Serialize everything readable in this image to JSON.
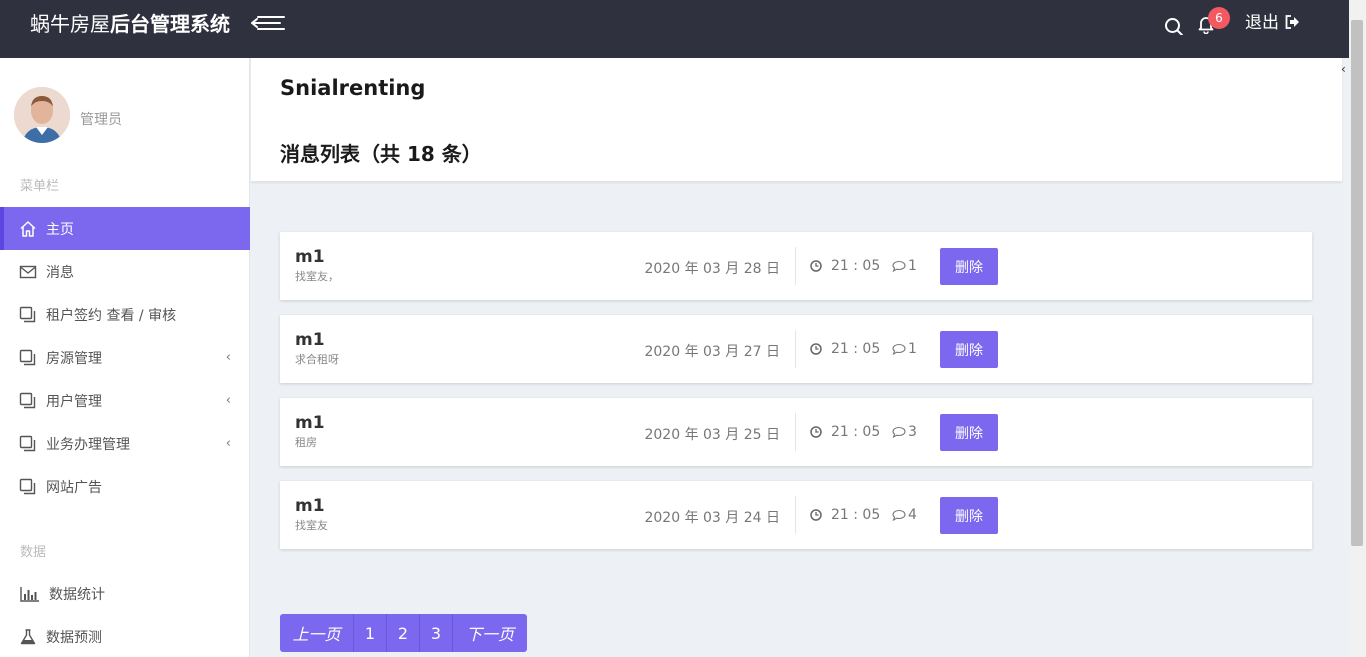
{
  "topbar": {
    "brand_light": "蜗牛房屋",
    "brand_bold": "后台管理系统",
    "notification_count": "6",
    "logout_label": "退出",
    "colors": {
      "background": "#2f323e",
      "badge": "#f25961"
    }
  },
  "sidebar": {
    "user_name": "管理员",
    "menu_section_title": "菜单栏",
    "data_section_title": "数据",
    "items": [
      {
        "label": "主页",
        "icon": "home-icon",
        "active": true,
        "has_arrow": false
      },
      {
        "label": "消息",
        "icon": "mail-icon",
        "active": false,
        "has_arrow": false
      },
      {
        "label": "租户签约 查看 / 审核",
        "icon": "copy-icon",
        "active": false,
        "has_arrow": false
      },
      {
        "label": "房源管理",
        "icon": "copy-icon",
        "active": false,
        "has_arrow": true
      },
      {
        "label": "用户管理",
        "icon": "copy-icon",
        "active": false,
        "has_arrow": true
      },
      {
        "label": "业务办理管理",
        "icon": "copy-icon",
        "active": false,
        "has_arrow": true
      },
      {
        "label": "网站广告",
        "icon": "copy-icon",
        "active": false,
        "has_arrow": false
      }
    ],
    "data_items": [
      {
        "label": "数据统计",
        "icon": "bar-chart-icon"
      },
      {
        "label": "数据预测",
        "icon": "flask-icon"
      }
    ],
    "arrow_glyph": "‹",
    "colors": {
      "active": "#7b68ee"
    }
  },
  "header": {
    "site_name": "Snialrenting",
    "list_title": "消息列表（共 18 条）"
  },
  "messages": [
    {
      "author": "m1",
      "content": "找室友，",
      "date": "2020 年 03 月 28 日",
      "time": "21 : 05",
      "comments": "1",
      "delete_label": "删除"
    },
    {
      "author": "m1",
      "content": "求合租呀",
      "date": "2020 年 03 月 27 日",
      "time": "21 : 05",
      "comments": "1",
      "delete_label": "删除"
    },
    {
      "author": "m1",
      "content": "租房",
      "date": "2020 年 03 月 25 日",
      "time": "21 : 05",
      "comments": "3",
      "delete_label": "删除"
    },
    {
      "author": "m1",
      "content": "找室友",
      "date": "2020 年 03 月 24 日",
      "time": "21 : 05",
      "comments": "4",
      "delete_label": "删除"
    }
  ],
  "pagination": {
    "prev_label": "上一页",
    "pages": [
      "1",
      "2",
      "3"
    ],
    "next_label": "下一页"
  }
}
